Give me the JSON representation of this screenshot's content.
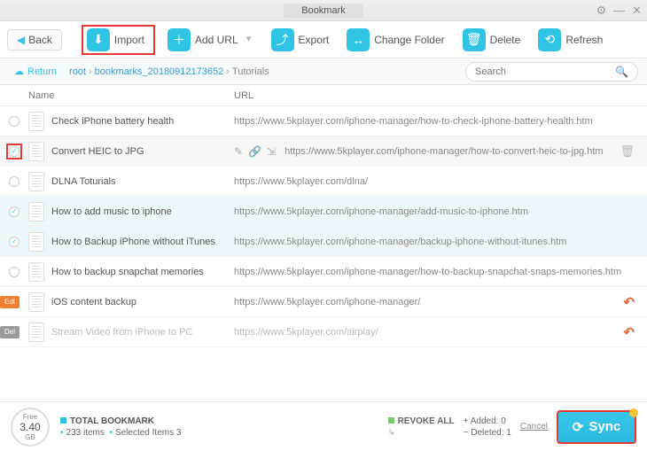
{
  "titlebar": {
    "title": "Bookmark"
  },
  "toolbar": {
    "back": "Back",
    "import": "Import",
    "add_url": "Add URL",
    "export": "Export",
    "change_folder": "Change Folder",
    "delete": "Delete",
    "refresh": "Refresh"
  },
  "pathbar": {
    "return": "Return",
    "crumbs": [
      "root",
      "bookmarks_20180912173652",
      "Tutorials"
    ],
    "search_placeholder": "Search"
  },
  "columns": {
    "name": "Name",
    "url": "URL"
  },
  "rows": [
    {
      "name": "Check iPhone battery health",
      "url": "https://www.5kplayer.com/iphone-manager/how-to-check-iphone-battery-health.htm",
      "checked": false
    },
    {
      "name": "Convert HEIC to JPG",
      "url": "https://www.5kplayer.com/iphone-manager/how-to-convert-heic-to-jpg.htm",
      "checked": true,
      "hover": true,
      "actions": true,
      "trash": true,
      "check_highlight": true
    },
    {
      "name": "DLNA Toturials",
      "url": "https://www.5kplayer.com/dlna/",
      "checked": false
    },
    {
      "name": "How to add music to iphone",
      "url": "https://www.5kplayer.com/iphone-manager/add-music-to-iphone.htm",
      "checked": true,
      "selected": true
    },
    {
      "name": "How to Backup iPhone without iTunes",
      "url": "https://www.5kplayer.com/iphone-manager/backup-iphone-without-itunes.htm",
      "checked": true,
      "selected": true
    },
    {
      "name": "How to backup snapchat memories",
      "url": "https://www.5kplayer.com/iphone-manager/how-to-backup-snapchat-snaps-memories.htm",
      "checked": false
    },
    {
      "name": "iOS content backup",
      "url": "https://www.5kplayer.com/iphone-manager/",
      "checked": false,
      "badge": "Edt",
      "badge_type": "edit",
      "undo": true
    },
    {
      "name": "Stream Video from iPhone to PC",
      "url": "https://www.5kplayer.com/airplay/",
      "checked": false,
      "badge": "Del",
      "badge_type": "del",
      "dim": true,
      "undo": true
    }
  ],
  "footer": {
    "free_label": "Free",
    "free_value": "3.40",
    "free_unit": "GB",
    "total_label": "TOTAL BOOKMARK",
    "items_text": "233 items",
    "selected_text": "Selected Items 3",
    "revoke_label": "REVOKE ALL",
    "added_label": "Added:",
    "added_value": "0",
    "deleted_label": "Deleted:",
    "deleted_value": "1",
    "cancel": "Cancel",
    "sync": "Sync"
  }
}
